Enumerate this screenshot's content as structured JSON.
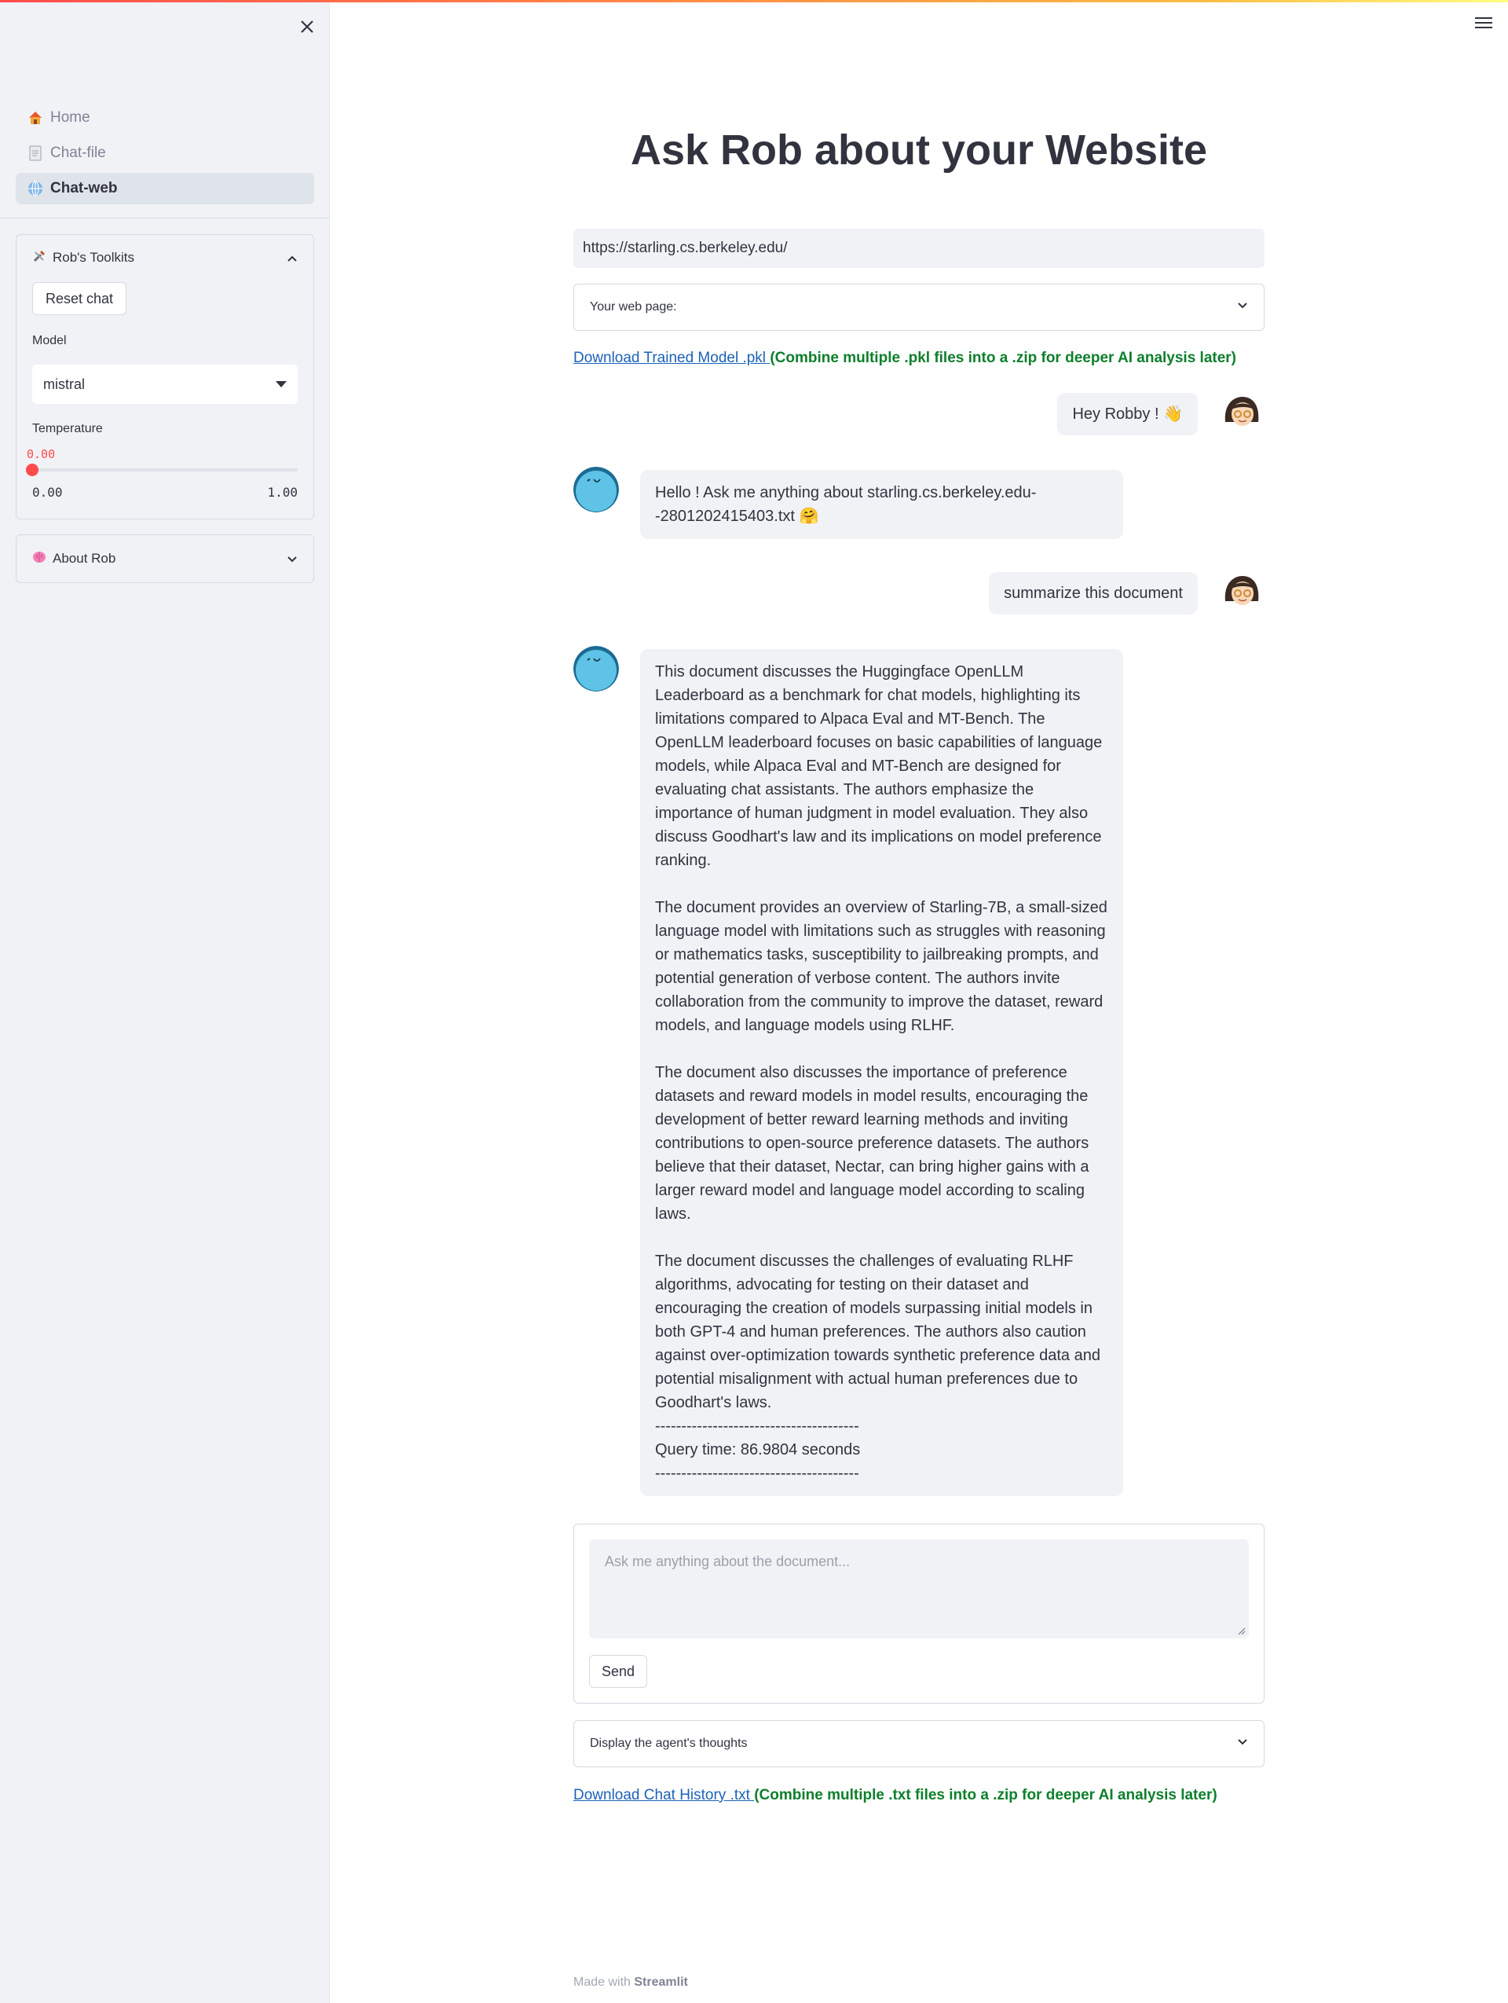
{
  "sidebar": {
    "nav": [
      {
        "label": "Home",
        "icon": "house-icon"
      },
      {
        "label": "Chat-file",
        "icon": "document-icon"
      },
      {
        "label": "Chat-web",
        "icon": "globe-icon",
        "active": true
      }
    ],
    "toolkits": {
      "title": "Rob's Toolkits",
      "reset_label": "Reset chat",
      "model_label": "Model",
      "model_value": "mistral",
      "temperature_label": "Temperature",
      "temperature_value": "0.00",
      "temperature_min": "0.00",
      "temperature_max": "1.00",
      "temperature_fraction": 0.0
    },
    "about": {
      "title": "About Rob"
    }
  },
  "main": {
    "title": "Ask Rob about your Website",
    "url_value": "https://starling.cs.berkeley.edu/",
    "web_page_expander": "Your web page:",
    "model_download": {
      "link": "Download Trained Model .pkl ",
      "note": "(Combine multiple .pkl files into a .zip for deeper AI analysis later)"
    },
    "messages": [
      {
        "role": "user",
        "text": "Hey Robby ! 👋"
      },
      {
        "role": "assistant",
        "text": "Hello ! Ask me anything about starling.cs.berkeley.edu--2801202415403.txt 🤗"
      },
      {
        "role": "user",
        "text": "summarize this document"
      },
      {
        "role": "assistant",
        "paragraphs": [
          "This document discusses the Huggingface OpenLLM Leaderboard as a benchmark for chat models, highlighting its limitations compared to Alpaca Eval and MT-Bench. The OpenLLM leaderboard focuses on basic capabilities of language models, while Alpaca Eval and MT-Bench are designed for evaluating chat assistants. The authors emphasize the importance of human judgment in model evaluation. They also discuss Goodhart's law and its implications on model preference ranking.",
          "The document provides an overview of Starling-7B, a small-sized language model with limitations such as struggles with reasoning or mathematics tasks, susceptibility to jailbreaking prompts, and potential generation of verbose content. The authors invite collaboration from the community to improve the dataset, reward models, and language models using RLHF.",
          "The document also discusses the importance of preference datasets and reward models in model results, encouraging the development of better reward learning methods and inviting contributions to open-source preference datasets. The authors believe that their dataset, Nectar, can bring higher gains with a larger reward model and language model according to scaling laws.",
          "The document discusses the challenges of evaluating RLHF algorithms, advocating for testing on their dataset and encouraging the creation of models surpassing initial models in both GPT-4 and human preferences. The authors also caution against over-optimization towards synthetic preference data and potential misalignment with actual human preferences due to Goodhart's laws."
        ],
        "divider": "---------------------------------------",
        "query_time": "Query time: 86.9804 seconds"
      }
    ],
    "input_placeholder": "Ask me anything about the document...",
    "send_label": "Send",
    "thoughts_expander": "Display the agent's thoughts",
    "history_download": {
      "link": "Download Chat History .txt ",
      "note": "(Combine multiple .txt files into a .zip for deeper AI analysis later)"
    }
  },
  "footer": {
    "prefix": "Made with ",
    "brand": "Streamlit"
  },
  "colors": {
    "accent": "#ff4b4b",
    "link": "#1c62b9",
    "green": "#0d7f2b",
    "bubble": "#f0f2f6"
  }
}
